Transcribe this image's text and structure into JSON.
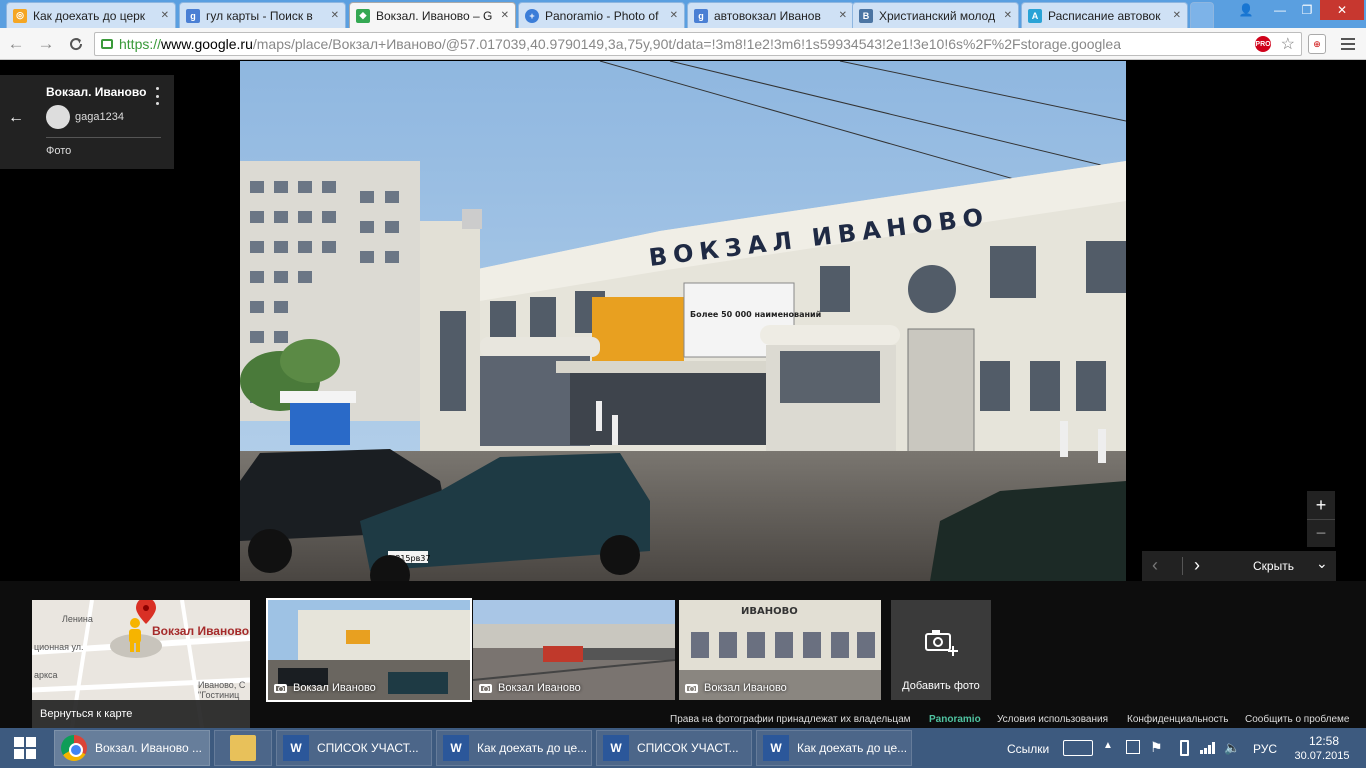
{
  "browser": {
    "tabs": [
      {
        "title": "Как доехать до церк",
        "favicon_color": "#f5a623",
        "favicon_text": "◎"
      },
      {
        "title": "гул карты - Поиск в",
        "favicon_color": "#4a7fd4",
        "favicon_text": "g"
      },
      {
        "title": "Вокзал. Иваново – G",
        "favicon_color": "#34a853",
        "favicon_text": "◆",
        "active": true
      },
      {
        "title": "Panoramio - Photo of",
        "favicon_color": "#3b7dd8",
        "favicon_text": "+"
      },
      {
        "title": "автовокзал Иванов",
        "favicon_color": "#4a7fd4",
        "favicon_text": "g"
      },
      {
        "title": "Христианский молод",
        "favicon_color": "#4c75a3",
        "favicon_text": "B"
      },
      {
        "title": "Расписание автовок",
        "favicon_color": "#2aa3d6",
        "favicon_text": "A"
      }
    ],
    "close_glyph": "✕",
    "window_controls": {
      "user": "👤",
      "minimize": "—",
      "maximize": "❐",
      "close": "✕"
    },
    "nav": {
      "back": "←",
      "forward": "→",
      "reload": "C"
    },
    "url": {
      "scheme": "https://",
      "host": "www.google.ru",
      "path": "/maps/place/Вокзал+Иваново/@57.017039,40.9790149,3a,75y,90t/data=!3m8!1e2!3m6!1s59934543!2e1!3e10!6s%2F%2Fstorage.googlea"
    },
    "pro_badge": "PRO",
    "star": "☆",
    "ext_label": "⊕"
  },
  "place": {
    "title": "Вокзал. Иваново",
    "author": "gaga1234",
    "photo_label": "Фото",
    "back_glyph": "←"
  },
  "photo": {
    "sign_text": "ВОКЗАЛ ИВАНОВО",
    "billboard_text": "Более 50 000 наименований",
    "plate_left": "н315рв37"
  },
  "controls": {
    "zoom_in": "+",
    "zoom_out": "−",
    "prev": "‹",
    "next": "›",
    "hide": "Скрыть",
    "collapse": "⌄"
  },
  "minimap": {
    "place": "Вокзал Иваново",
    "back_label": "Вернуться к карте",
    "streets": [
      "Ленина",
      "ционная ул.",
      "Иваново, С",
      "\"Гостиниц",
      "аркса"
    ]
  },
  "thumbnails": [
    {
      "label": "Вокзал Иваново",
      "selected": true
    },
    {
      "label": "Вокзал Иваново"
    },
    {
      "label": "Вокзал Иваново",
      "sign": "ИВАНОВО"
    }
  ],
  "add_photo": "Добавить фото",
  "footer": {
    "rights": "Права на фотографии принадлежат их владельцам",
    "panoramio": "Panoramio",
    "terms": "Условия использования",
    "privacy": "Конфиденциальность",
    "report": "Сообщить о проблеме"
  },
  "taskbar": {
    "items": [
      {
        "label": "Вокзал. Иваново ...",
        "icon": "chrome",
        "active": true
      },
      {
        "label": "",
        "icon": "folder"
      },
      {
        "label": "СПИСОК УЧАСТ...",
        "icon": "word"
      },
      {
        "label": "Как доехать до це...",
        "icon": "word"
      },
      {
        "label": "СПИСОК УЧАСТ...",
        "icon": "word"
      },
      {
        "label": "Как доехать до це...",
        "icon": "word"
      }
    ],
    "links": "Ссылки",
    "lang": "РУС",
    "time": "12:58",
    "date": "30.07.2015"
  },
  "colors": {
    "tabstrip": "#5a9fe0",
    "taskbar": "#3d5a7f",
    "sky": "#9ec2e4",
    "building": "#e6e4da"
  }
}
